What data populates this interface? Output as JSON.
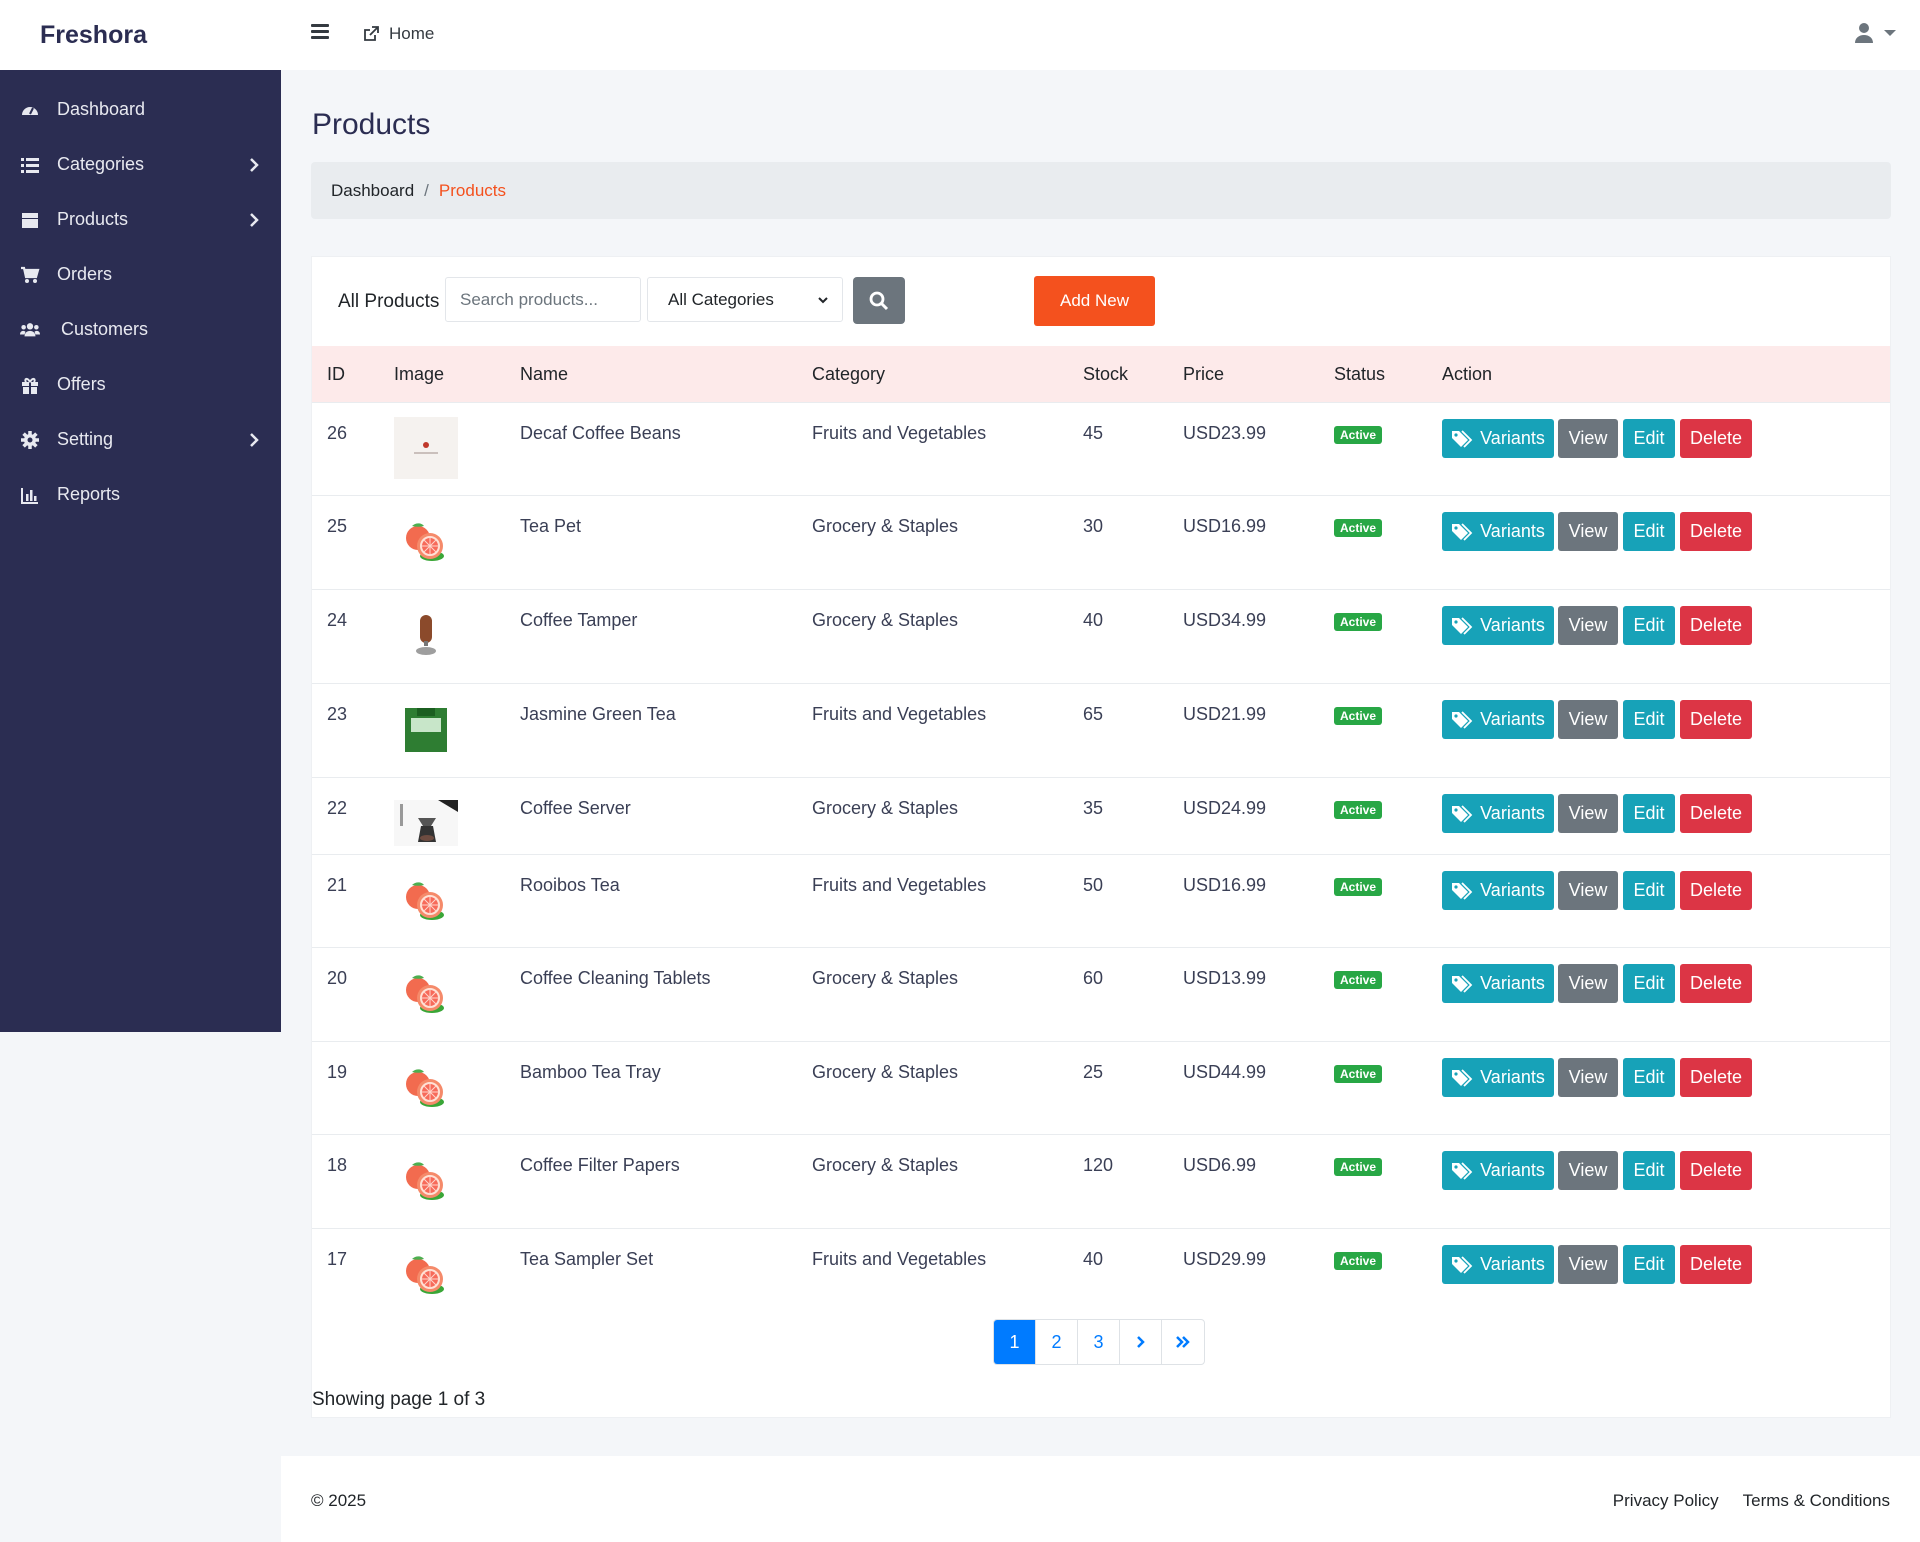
{
  "app": {
    "brand": "Freshora"
  },
  "topbar": {
    "home_label": "Home"
  },
  "sidebar": {
    "items": [
      {
        "label": "Dashboard",
        "icon": "dashboard-icon",
        "has_submenu": false
      },
      {
        "label": "Categories",
        "icon": "list-icon",
        "has_submenu": true
      },
      {
        "label": "Products",
        "icon": "box-icon",
        "has_submenu": true
      },
      {
        "label": "Orders",
        "icon": "cart-icon",
        "has_submenu": false
      },
      {
        "label": "Customers",
        "icon": "users-icon",
        "has_submenu": false
      },
      {
        "label": "Offers",
        "icon": "gift-icon",
        "has_submenu": false
      },
      {
        "label": "Setting",
        "icon": "gear-icon",
        "has_submenu": true
      },
      {
        "label": "Reports",
        "icon": "bar-chart-icon",
        "has_submenu": false
      }
    ]
  },
  "page": {
    "title": "Products"
  },
  "breadcrumb": {
    "home": "Dashboard",
    "separator": "/",
    "current": "Products"
  },
  "toolbar": {
    "title": "All Products",
    "search_placeholder": "Search products...",
    "category_selected": "All Categories",
    "add_label": "Add New"
  },
  "table": {
    "headers": [
      "ID",
      "Image",
      "Name",
      "Category",
      "Stock",
      "Price",
      "Status",
      "Action"
    ],
    "rows": [
      {
        "id": "26",
        "image": "logo",
        "name": "Decaf Coffee Beans",
        "category": "Fruits and Vegetables",
        "stock": "45",
        "price": "USD23.99",
        "status": "Active"
      },
      {
        "id": "25",
        "image": "grapefruit",
        "name": "Tea Pet",
        "category": "Grocery & Staples",
        "stock": "30",
        "price": "USD16.99",
        "status": "Active"
      },
      {
        "id": "24",
        "image": "tamper",
        "name": "Coffee Tamper",
        "category": "Grocery & Staples",
        "stock": "40",
        "price": "USD34.99",
        "status": "Active"
      },
      {
        "id": "23",
        "image": "tea-box",
        "name": "Jasmine Green Tea",
        "category": "Fruits and Vegetables",
        "stock": "65",
        "price": "USD21.99",
        "status": "Active"
      },
      {
        "id": "22",
        "image": "coffee-server",
        "name": "Coffee Server",
        "category": "Grocery & Staples",
        "stock": "35",
        "price": "USD24.99",
        "status": "Active"
      },
      {
        "id": "21",
        "image": "grapefruit",
        "name": "Rooibos Tea",
        "category": "Fruits and Vegetables",
        "stock": "50",
        "price": "USD16.99",
        "status": "Active"
      },
      {
        "id": "20",
        "image": "grapefruit",
        "name": "Coffee Cleaning Tablets",
        "category": "Grocery & Staples",
        "stock": "60",
        "price": "USD13.99",
        "status": "Active"
      },
      {
        "id": "19",
        "image": "grapefruit",
        "name": "Bamboo Tea Tray",
        "category": "Grocery & Staples",
        "stock": "25",
        "price": "USD44.99",
        "status": "Active"
      },
      {
        "id": "18",
        "image": "grapefruit",
        "name": "Coffee Filter Papers",
        "category": "Grocery & Staples",
        "stock": "120",
        "price": "USD6.99",
        "status": "Active"
      },
      {
        "id": "17",
        "image": "grapefruit",
        "name": "Tea Sampler Set",
        "category": "Fruits and Vegetables",
        "stock": "40",
        "price": "USD29.99",
        "status": "Active"
      }
    ],
    "actions": {
      "variants": "Variants",
      "view": "View",
      "edit": "Edit",
      "delete": "Delete"
    }
  },
  "pagination": {
    "pages": [
      "1",
      "2",
      "3"
    ],
    "current": "1",
    "showing_text": "Showing page 1 of 3"
  },
  "footer": {
    "copyright": "© 2025",
    "privacy": "Privacy Policy",
    "terms": "Terms & Conditions"
  },
  "colors": {
    "sidebar_bg": "#2b2d52",
    "accent": "#f4511e",
    "info": "#17a2b8",
    "danger": "#dc3545",
    "secondary": "#6c757d",
    "success": "#28a745",
    "primary": "#007bff"
  }
}
